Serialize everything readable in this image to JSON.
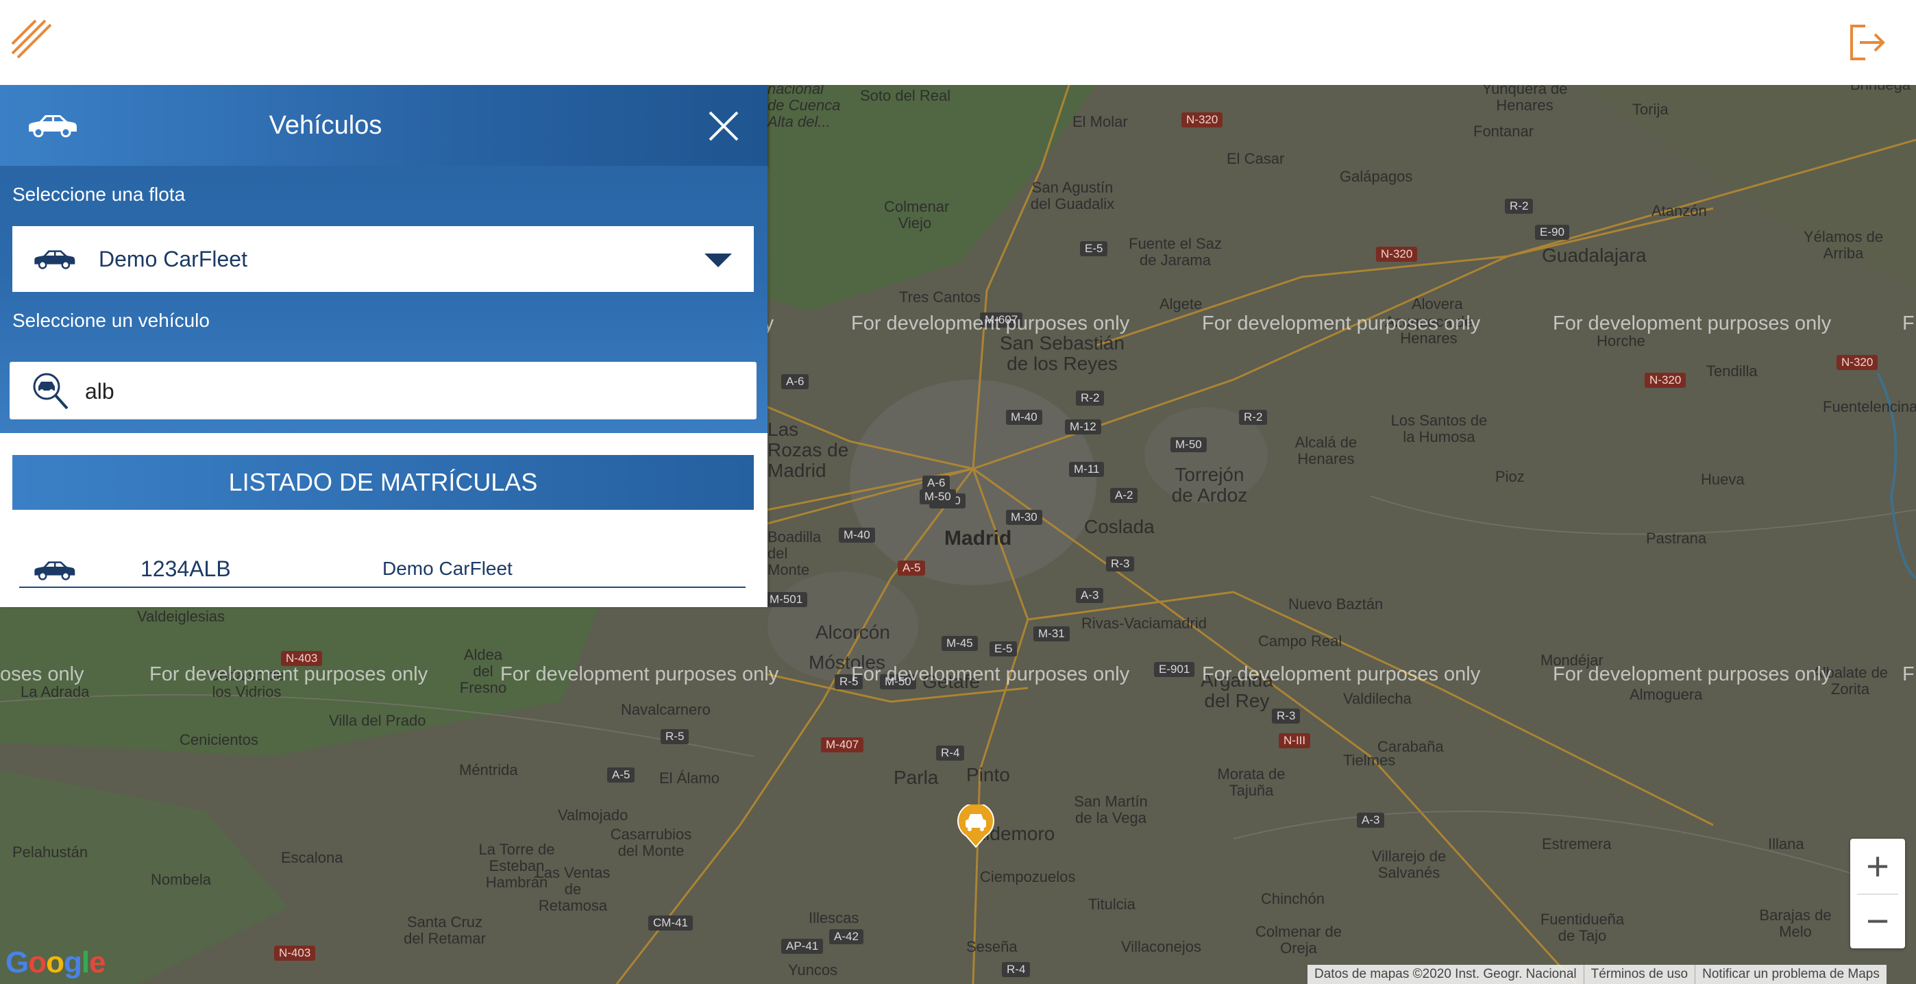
{
  "header": {
    "menu_icon": "diagonal-lines-icon",
    "logout_icon": "logout-icon",
    "accent": "#e8883a"
  },
  "panel": {
    "title": "Vehículos",
    "fleet_label": "Seleccione una flota",
    "fleet_value": "Demo CarFleet",
    "vehicle_label": "Seleccione un vehículo",
    "search_value": "alb",
    "list_header": "LISTADO DE MATRÍCULAS",
    "rows": [
      {
        "plate": "1234ALB",
        "fleet": "Demo CarFleet"
      }
    ],
    "brand_color": "#2a66a6"
  },
  "map": {
    "watermark": "For development purposes only",
    "watermark_partial_left": "oses only",
    "watermark_partial_top_left": "nly",
    "watermark_partial_right": "F",
    "places": [
      "Soto del Real",
      "El Molar",
      "Yunquera de Henares",
      "Torija",
      "Brihuega",
      "Fontanar",
      "nacional de Cuenca Alta del...",
      "El Casar",
      "Galápagos",
      "San Agustín del Guadalix",
      "Colmenar Viejo",
      "Fuente el Saz de Jarama",
      "Guadalajara",
      "Atanzón",
      "Yélamos de Arriba",
      "Tres Cantos",
      "Algete",
      "Alovera",
      "Azuqueca de Henares",
      "Horche",
      "San Sebastián de los Reyes",
      "Tendilla",
      "Fuentelencina",
      "Las Rozas de Madrid",
      "Los Santos de la Humosa",
      "Alcalá de Henares",
      "Torrejón de Ardoz",
      "Pioz",
      "Hueva",
      "Boadilla del Monte",
      "Madrid",
      "Coslada",
      "Pastrana",
      "Valdeiglesias",
      "Alcorcón",
      "Nuevo Baztán",
      "Rivas-Vaciamadrid",
      "Aldea del Fresno",
      "Móstoles",
      "Getafe",
      "Campo Real",
      "La Adrada",
      "Cadalso de los Vidrios",
      "Arganda del Rey",
      "Valdilecha",
      "Mondéjar",
      "Albalate de Zorita",
      "Almoguera",
      "Villa del Prado",
      "Navalcarnero",
      "Cenicientos",
      "Pinto",
      "Carabaña",
      "Méntrida",
      "El Álamo",
      "Parla",
      "Tielmes",
      "Morata de Tajuña",
      "San Martín de la Vega",
      "Valmojado",
      "Casarrubios del Monte",
      "Valdemoro",
      "Pelahustán",
      "Estremera",
      "Illana",
      "Escalona",
      "Nombela",
      "La Torre de Esteban Hambrán",
      "Las Ventas de Retamosa",
      "Villarejo de Salvanés",
      "Ciempozuelos",
      "Titulcia",
      "Chinchón",
      "Fuentidueña de Tajo",
      "Barajas de Melo",
      "Santa Cruz del Retamar",
      "Illescas",
      "Seseña",
      "Villaconejos",
      "Colmenar de Oreja",
      "Yuncos"
    ],
    "roads": [
      "N-320",
      "R-2",
      "E-90",
      "N-320",
      "E-5",
      "M-607",
      "A-6",
      "R-2",
      "M-12",
      "M-40",
      "M-50",
      "R-2",
      "N-320",
      "M-11",
      "A-6",
      "M-30",
      "A-2",
      "M-40",
      "M-30",
      "A-5",
      "R-3",
      "M-50",
      "A-3",
      "M-45",
      "M-31",
      "E-5",
      "E-901",
      "R-5",
      "M-50",
      "R-3",
      "N-III",
      "R-5",
      "M-407",
      "R-4",
      "A-5",
      "A-3",
      "CM-41",
      "A-42",
      "AP-41",
      "R-4",
      "N-403",
      "N-403",
      "M-501",
      "N-320"
    ],
    "zoom_in": "+",
    "zoom_out": "−",
    "google_logo": "Google",
    "attribution": [
      "Datos de mapas ©2020 Inst. Geogr. Nacional",
      "Términos de uso",
      "Notificar un problema de Maps"
    ]
  }
}
